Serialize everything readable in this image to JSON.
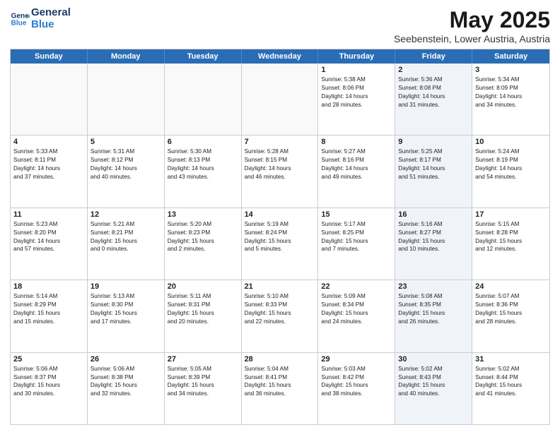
{
  "header": {
    "logo_line1": "General",
    "logo_line2": "Blue",
    "title": "May 2025",
    "subtitle": "Seebenstein, Lower Austria, Austria"
  },
  "days": [
    "Sunday",
    "Monday",
    "Tuesday",
    "Wednesday",
    "Thursday",
    "Friday",
    "Saturday"
  ],
  "rows": [
    [
      {
        "day": "",
        "text": "",
        "shaded": false
      },
      {
        "day": "",
        "text": "",
        "shaded": false
      },
      {
        "day": "",
        "text": "",
        "shaded": false
      },
      {
        "day": "",
        "text": "",
        "shaded": false
      },
      {
        "day": "1",
        "text": "Sunrise: 5:38 AM\nSunset: 8:06 PM\nDaylight: 14 hours\nand 28 minutes.",
        "shaded": false
      },
      {
        "day": "2",
        "text": "Sunrise: 5:36 AM\nSunset: 8:08 PM\nDaylight: 14 hours\nand 31 minutes.",
        "shaded": true
      },
      {
        "day": "3",
        "text": "Sunrise: 5:34 AM\nSunset: 8:09 PM\nDaylight: 14 hours\nand 34 minutes.",
        "shaded": false
      }
    ],
    [
      {
        "day": "4",
        "text": "Sunrise: 5:33 AM\nSunset: 8:11 PM\nDaylight: 14 hours\nand 37 minutes.",
        "shaded": false
      },
      {
        "day": "5",
        "text": "Sunrise: 5:31 AM\nSunset: 8:12 PM\nDaylight: 14 hours\nand 40 minutes.",
        "shaded": false
      },
      {
        "day": "6",
        "text": "Sunrise: 5:30 AM\nSunset: 8:13 PM\nDaylight: 14 hours\nand 43 minutes.",
        "shaded": false
      },
      {
        "day": "7",
        "text": "Sunrise: 5:28 AM\nSunset: 8:15 PM\nDaylight: 14 hours\nand 46 minutes.",
        "shaded": false
      },
      {
        "day": "8",
        "text": "Sunrise: 5:27 AM\nSunset: 8:16 PM\nDaylight: 14 hours\nand 49 minutes.",
        "shaded": false
      },
      {
        "day": "9",
        "text": "Sunrise: 5:25 AM\nSunset: 8:17 PM\nDaylight: 14 hours\nand 51 minutes.",
        "shaded": true
      },
      {
        "day": "10",
        "text": "Sunrise: 5:24 AM\nSunset: 8:19 PM\nDaylight: 14 hours\nand 54 minutes.",
        "shaded": false
      }
    ],
    [
      {
        "day": "11",
        "text": "Sunrise: 5:23 AM\nSunset: 8:20 PM\nDaylight: 14 hours\nand 57 minutes.",
        "shaded": false
      },
      {
        "day": "12",
        "text": "Sunrise: 5:21 AM\nSunset: 8:21 PM\nDaylight: 15 hours\nand 0 minutes.",
        "shaded": false
      },
      {
        "day": "13",
        "text": "Sunrise: 5:20 AM\nSunset: 8:23 PM\nDaylight: 15 hours\nand 2 minutes.",
        "shaded": false
      },
      {
        "day": "14",
        "text": "Sunrise: 5:19 AM\nSunset: 8:24 PM\nDaylight: 15 hours\nand 5 minutes.",
        "shaded": false
      },
      {
        "day": "15",
        "text": "Sunrise: 5:17 AM\nSunset: 8:25 PM\nDaylight: 15 hours\nand 7 minutes.",
        "shaded": false
      },
      {
        "day": "16",
        "text": "Sunrise: 5:16 AM\nSunset: 8:27 PM\nDaylight: 15 hours\nand 10 minutes.",
        "shaded": true
      },
      {
        "day": "17",
        "text": "Sunrise: 5:15 AM\nSunset: 8:28 PM\nDaylight: 15 hours\nand 12 minutes.",
        "shaded": false
      }
    ],
    [
      {
        "day": "18",
        "text": "Sunrise: 5:14 AM\nSunset: 8:29 PM\nDaylight: 15 hours\nand 15 minutes.",
        "shaded": false
      },
      {
        "day": "19",
        "text": "Sunrise: 5:13 AM\nSunset: 8:30 PM\nDaylight: 15 hours\nand 17 minutes.",
        "shaded": false
      },
      {
        "day": "20",
        "text": "Sunrise: 5:11 AM\nSunset: 8:31 PM\nDaylight: 15 hours\nand 20 minutes.",
        "shaded": false
      },
      {
        "day": "21",
        "text": "Sunrise: 5:10 AM\nSunset: 8:33 PM\nDaylight: 15 hours\nand 22 minutes.",
        "shaded": false
      },
      {
        "day": "22",
        "text": "Sunrise: 5:09 AM\nSunset: 8:34 PM\nDaylight: 15 hours\nand 24 minutes.",
        "shaded": false
      },
      {
        "day": "23",
        "text": "Sunrise: 5:08 AM\nSunset: 8:35 PM\nDaylight: 15 hours\nand 26 minutes.",
        "shaded": true
      },
      {
        "day": "24",
        "text": "Sunrise: 5:07 AM\nSunset: 8:36 PM\nDaylight: 15 hours\nand 28 minutes.",
        "shaded": false
      }
    ],
    [
      {
        "day": "25",
        "text": "Sunrise: 5:06 AM\nSunset: 8:37 PM\nDaylight: 15 hours\nand 30 minutes.",
        "shaded": false
      },
      {
        "day": "26",
        "text": "Sunrise: 5:06 AM\nSunset: 8:38 PM\nDaylight: 15 hours\nand 32 minutes.",
        "shaded": false
      },
      {
        "day": "27",
        "text": "Sunrise: 5:05 AM\nSunset: 8:39 PM\nDaylight: 15 hours\nand 34 minutes.",
        "shaded": false
      },
      {
        "day": "28",
        "text": "Sunrise: 5:04 AM\nSunset: 8:41 PM\nDaylight: 15 hours\nand 36 minutes.",
        "shaded": false
      },
      {
        "day": "29",
        "text": "Sunrise: 5:03 AM\nSunset: 8:42 PM\nDaylight: 15 hours\nand 38 minutes.",
        "shaded": false
      },
      {
        "day": "30",
        "text": "Sunrise: 5:02 AM\nSunset: 8:43 PM\nDaylight: 15 hours\nand 40 minutes.",
        "shaded": true
      },
      {
        "day": "31",
        "text": "Sunrise: 5:02 AM\nSunset: 8:44 PM\nDaylight: 15 hours\nand 41 minutes.",
        "shaded": false
      }
    ]
  ]
}
